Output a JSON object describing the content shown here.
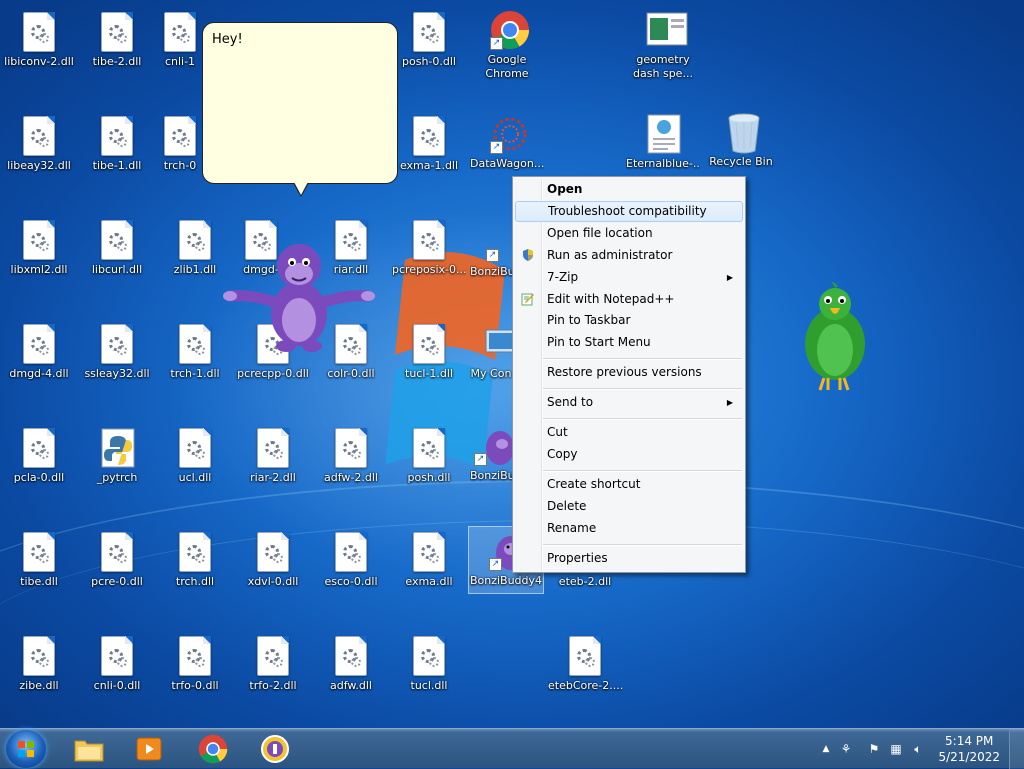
{
  "bubble": {
    "text": "Hey!"
  },
  "icons": {
    "libiconv2": "libiconv-2.dll",
    "tibe2": "tibe-2.dll",
    "cnli1": "cnli-1",
    "posh0": "posh-0.dll",
    "chrome": "Google Chrome",
    "geometry": "geometry dash spe...",
    "libeay32": "libeay32.dll",
    "tibe1": "tibe-1.dll",
    "trch0": "trch-0",
    "exma1": "exma-1.dll",
    "datawagon": "DataWagon...",
    "eternalblue": "Eternalblue-...",
    "recyclebin": "Recycle Bin",
    "libxml2": "libxml2.dll",
    "libcurl": "libcurl.dll",
    "zlib1": "zlib1.dll",
    "dmgd": "dmgd-",
    "riar": "riar.dll",
    "pcreposix": "pcreposix-0...",
    "bonzib1": "BonziBu",
    "dmgd4": "dmgd-4.dll",
    "ssleay32": "ssleay32.dll",
    "trch1": "trch-1.dll",
    "pcrecpp": "pcrecpp-0.dll",
    "colr0": "colr-0.dll",
    "tucl1": "tucl-1.dll",
    "mycomputer": "My Con",
    "pcla0": "pcla-0.dll",
    "pytrch": "_pytrch",
    "ucl": "ucl.dll",
    "riar2": "riar-2.dll",
    "adfw2": "adfw-2.dll",
    "posh": "posh.dll",
    "bonzib2": "BonziBu",
    "tibe": "tibe.dll",
    "pcre0": "pcre-0.dll",
    "trch": "trch.dll",
    "xdvl0": "xdvl-0.dll",
    "esco0": "esco-0.dll",
    "exma": "exma.dll",
    "bonzibuddy4": "BonziBuddy4",
    "eteb2": "eteb-2.dll",
    "zibe": "zibe.dll",
    "cnli0": "cnli-0.dll",
    "trfo0": "trfo-0.dll",
    "trfo2": "trfo-2.dll",
    "adfw": "adfw.dll",
    "tucl": "tucl.dll",
    "etebcore": "etebCore-2...."
  },
  "context_menu": {
    "open": "Open",
    "troubleshoot": "Troubleshoot compatibility",
    "open_location": "Open file location",
    "run_admin": "Run as administrator",
    "sevenzip": "7-Zip",
    "notepadpp": "Edit with Notepad++",
    "pin_taskbar": "Pin to Taskbar",
    "pin_start": "Pin to Start Menu",
    "restore": "Restore previous versions",
    "send_to": "Send to",
    "cut": "Cut",
    "copy": "Copy",
    "create_shortcut": "Create shortcut",
    "delete": "Delete",
    "rename": "Rename",
    "properties": "Properties"
  },
  "taskbar": {
    "time": "5:14 PM",
    "date": "5/21/2022"
  },
  "colors": {
    "desktop": "#1668c7",
    "menu_bg": "#f5f6f7",
    "menu_hover": "#dcebfc",
    "bubble_bg": "#ffffe1",
    "taskbar": "#2c5480"
  }
}
